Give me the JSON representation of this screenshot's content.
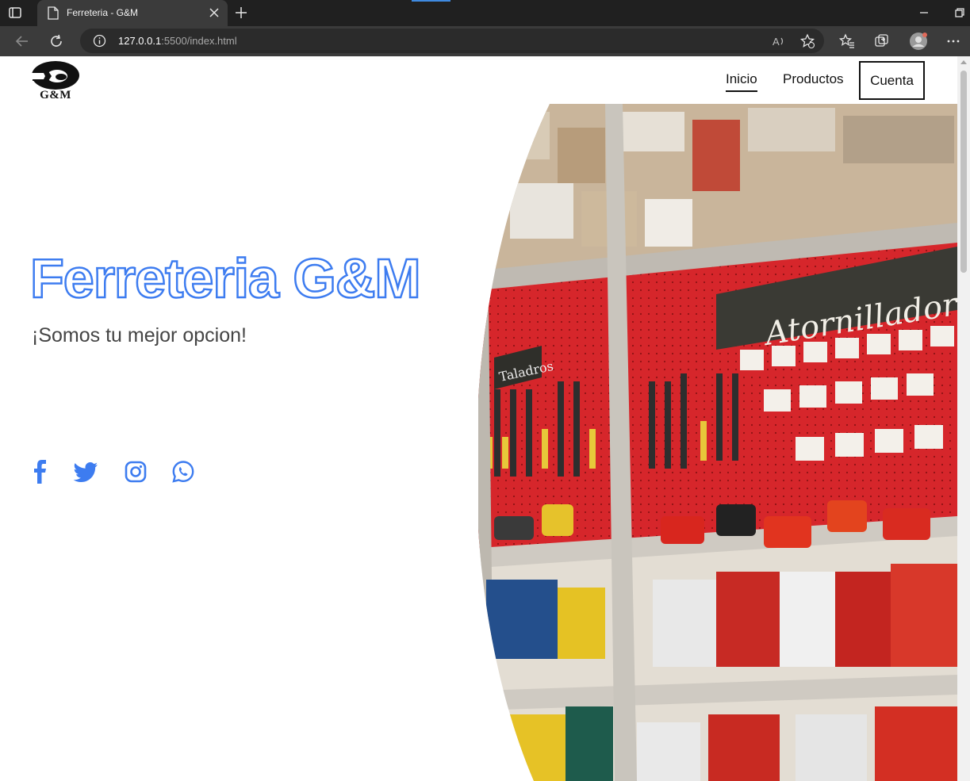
{
  "browser": {
    "tab_title": "Ferreteria - G&M",
    "url_host": "127.0.0.1",
    "url_rest": ":5500/index.html",
    "accent_color": "#3f8ae0"
  },
  "page": {
    "logo_text": "G&M",
    "nav": {
      "items": [
        {
          "label": "Inicio",
          "active": true
        },
        {
          "label": "Productos",
          "active": false
        }
      ],
      "account_button": "Cuenta"
    },
    "hero": {
      "title": "Ferreteria G&M",
      "subtitle": "¡Somos tu mejor opcion!",
      "accent_color": "#3d7cf0"
    },
    "social": [
      {
        "icon": "facebook-icon"
      },
      {
        "icon": "twitter-icon"
      },
      {
        "icon": "instagram-icon"
      },
      {
        "icon": "whatsapp-icon"
      }
    ],
    "image_sign_text": "Atornilladores",
    "image_side_sign_text": "Taladros"
  }
}
